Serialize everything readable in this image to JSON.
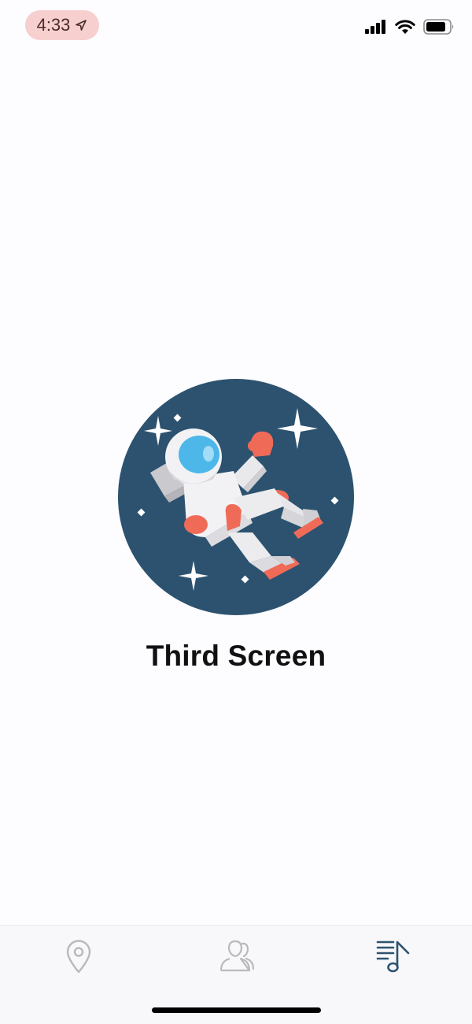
{
  "status_bar": {
    "time": "4:33",
    "location_icon": "location-arrow-icon",
    "signal_icon": "cellular-signal-icon",
    "wifi_icon": "wifi-icon",
    "battery_icon": "battery-icon",
    "time_highlight_color": "#f7cfcf"
  },
  "main": {
    "title": "Third Screen",
    "illustration_icon": "astronaut-icon",
    "illustration_bg_color": "#2c526f"
  },
  "tab_bar": {
    "tabs": [
      {
        "icon": "location-pin-icon",
        "selected": false
      },
      {
        "icon": "contacts-icon",
        "selected": false
      },
      {
        "icon": "music-playlist-icon",
        "selected": true
      }
    ],
    "active_color": "#2c5470",
    "inactive_color": "#b9b9bd"
  }
}
